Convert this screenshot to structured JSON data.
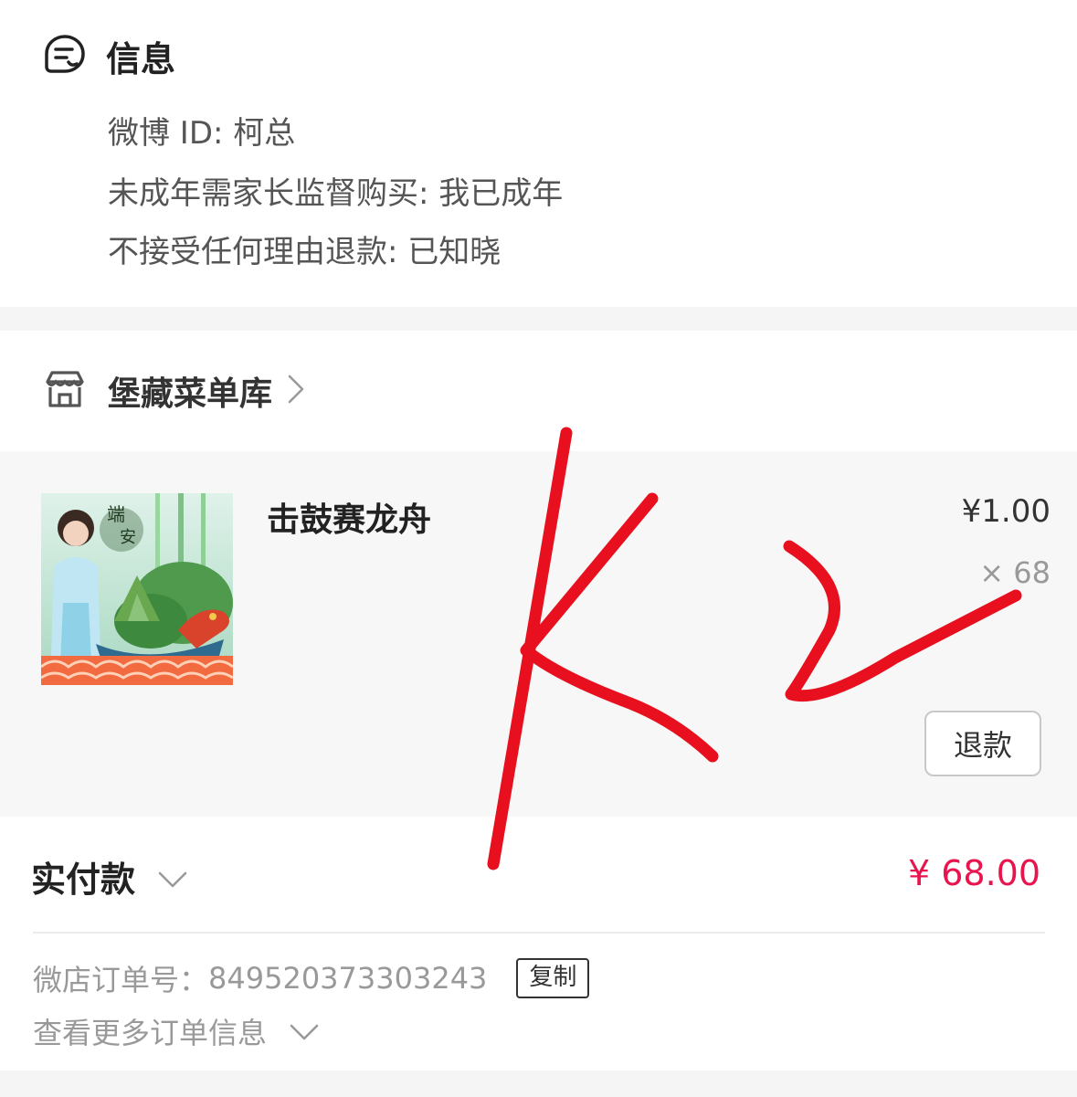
{
  "info": {
    "title": "信息",
    "lines": [
      "微博 ID: 柯总",
      "未成年需家长监督购买: 我已成年",
      "不接受任何理由退款: 已知晓"
    ]
  },
  "shop": {
    "name": "堡藏菜单库"
  },
  "item": {
    "title": "击鼓赛龙舟",
    "price": "¥1.00",
    "qty": "× 68",
    "refund_label": "退款"
  },
  "payment": {
    "label": "实付款",
    "amount": "¥ 68.00"
  },
  "order": {
    "label": "微店订单号：",
    "number": "849520373303243",
    "copy_label": "复制",
    "more_label": "查看更多订单信息"
  },
  "colors": {
    "accent": "#e8144e",
    "handwriting": "#e8101e"
  }
}
